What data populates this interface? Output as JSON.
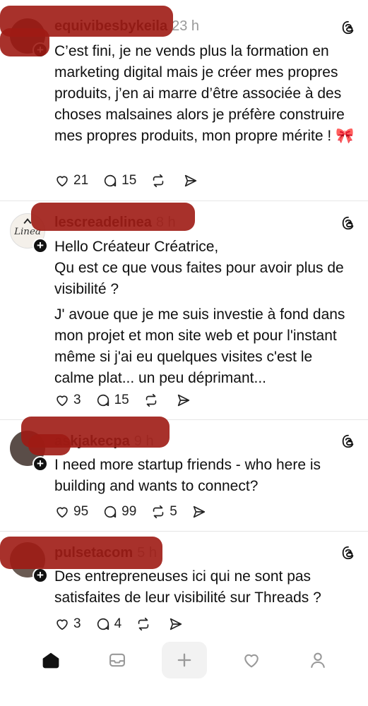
{
  "posts": [
    {
      "username": "equivibesbykeila",
      "time": "23 h",
      "paragraphs": [
        "C’est fini, je ne vends plus la formation en marketing digital mais je créer mes propres produits, j’en ai marre d’être associée à des choses malsaines alors je préfère construire mes propres produits, mon propre mérite ! 🎀"
      ],
      "likes": "21",
      "replies": "15",
      "reposts": "",
      "avatar_icon": "profile-photo"
    },
    {
      "username": "lescreadelinea",
      "time": "8 h",
      "paragraphs": [
        "Hello Créateur Créatrice,",
        "Qu est ce que vous faites pour avoir plus de visibilité ?",
        "J' avoue que je me suis investie à fond dans mon projet et mon site web et pour l'instant même si j'ai eu quelques visites c'est le calme plat... un peu déprimant..."
      ],
      "likes": "3",
      "replies": "15",
      "reposts": "",
      "avatar_icon": "logo-avatar"
    },
    {
      "username": "askjakecpa",
      "time": "9 h",
      "paragraphs": [
        "I need more startup friends - who here is building and wants to connect?"
      ],
      "likes": "95",
      "replies": "99",
      "reposts": "5",
      "avatar_icon": "profile-photo"
    },
    {
      "username": "pulsetacom",
      "time": "5 h",
      "paragraphs": [
        "Des entrepreneuses ici qui ne sont pas satisfaites de leur visibilité sur Threads ?"
      ],
      "likes": "3",
      "replies": "4",
      "reposts": "",
      "avatar_icon": "profile-photo"
    }
  ],
  "tabbar": {
    "items": [
      "home-icon",
      "inbox-icon",
      "plus-icon",
      "heart-icon",
      "profile-icon"
    ],
    "active": "home-icon"
  },
  "colors": {
    "redaction": "#9e1b14",
    "text": "#101010",
    "muted": "#999999"
  }
}
